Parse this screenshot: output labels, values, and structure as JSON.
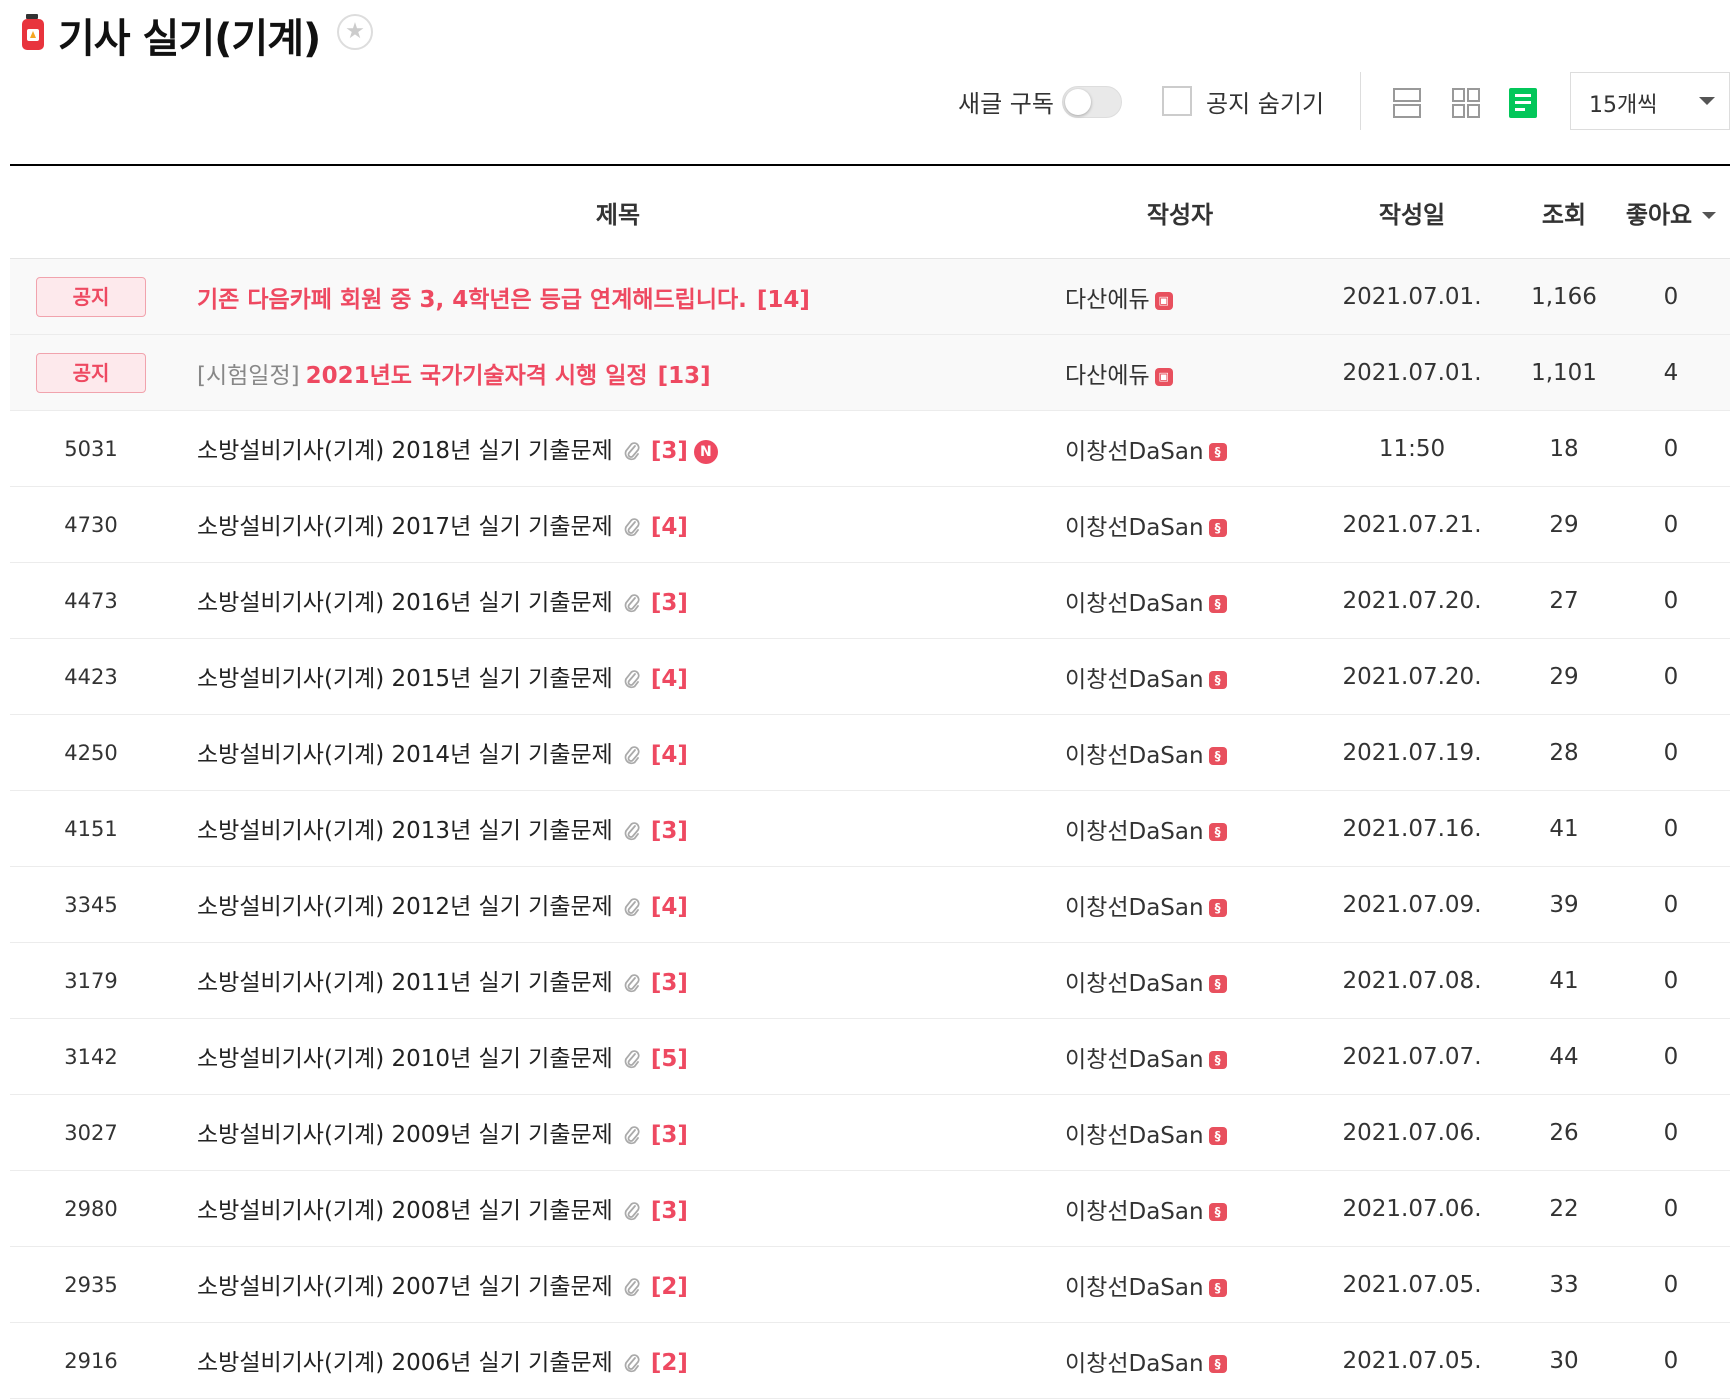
{
  "board": {
    "title": "기사 실기(기계)",
    "star_icon": "star-icon",
    "board_icon": "fire-extinguisher-icon"
  },
  "toolbar": {
    "subscribe_label": "새글 구독",
    "hide_notice_label": "공지 숨기기",
    "per_page": "15개씩",
    "view_icons": [
      "list-view-icon",
      "card-view-icon",
      "album-view-icon"
    ],
    "active_view_color": "#03c75a"
  },
  "columns": {
    "title": "제목",
    "author": "작성자",
    "date": "작성일",
    "views": "조회",
    "likes": "좋아요"
  },
  "notices": [
    {
      "badge": "공지",
      "prefix": "",
      "title": "기존 다음카페 회원 중 3, 4학년은 등급 연계해드립니다.",
      "comments": "[14]",
      "author": "다산에듀",
      "date": "2021.07.01.",
      "views": "1,166",
      "likes": "0"
    },
    {
      "badge": "공지",
      "prefix": "[시험일정]",
      "title": "2021년도 국가기술자격 시행 일정",
      "comments": "[13]",
      "author": "다산에듀",
      "date": "2021.07.01.",
      "views": "1,101",
      "likes": "4"
    }
  ],
  "posts": [
    {
      "num": "5031",
      "title": "소방설비기사(기계) 2018년 실기 기출문제",
      "comments": "[3]",
      "new": "N",
      "author": "이창선DaSan",
      "date": "11:50",
      "views": "18",
      "likes": "0"
    },
    {
      "num": "4730",
      "title": "소방설비기사(기계) 2017년 실기 기출문제",
      "comments": "[4]",
      "author": "이창선DaSan",
      "date": "2021.07.21.",
      "views": "29",
      "likes": "0"
    },
    {
      "num": "4473",
      "title": "소방설비기사(기계) 2016년 실기 기출문제",
      "comments": "[3]",
      "author": "이창선DaSan",
      "date": "2021.07.20.",
      "views": "27",
      "likes": "0"
    },
    {
      "num": "4423",
      "title": "소방설비기사(기계) 2015년 실기 기출문제",
      "comments": "[4]",
      "author": "이창선DaSan",
      "date": "2021.07.20.",
      "views": "29",
      "likes": "0"
    },
    {
      "num": "4250",
      "title": "소방설비기사(기계) 2014년 실기 기출문제",
      "comments": "[4]",
      "author": "이창선DaSan",
      "date": "2021.07.19.",
      "views": "28",
      "likes": "0"
    },
    {
      "num": "4151",
      "title": "소방설비기사(기계) 2013년 실기 기출문제",
      "comments": "[3]",
      "author": "이창선DaSan",
      "date": "2021.07.16.",
      "views": "41",
      "likes": "0"
    },
    {
      "num": "3345",
      "title": "소방설비기사(기계) 2012년 실기 기출문제",
      "comments": "[4]",
      "author": "이창선DaSan",
      "date": "2021.07.09.",
      "views": "39",
      "likes": "0"
    },
    {
      "num": "3179",
      "title": "소방설비기사(기계) 2011년 실기 기출문제",
      "comments": "[3]",
      "author": "이창선DaSan",
      "date": "2021.07.08.",
      "views": "41",
      "likes": "0"
    },
    {
      "num": "3142",
      "title": "소방설비기사(기계) 2010년 실기 기출문제",
      "comments": "[5]",
      "author": "이창선DaSan",
      "date": "2021.07.07.",
      "views": "44",
      "likes": "0"
    },
    {
      "num": "3027",
      "title": "소방설비기사(기계) 2009년 실기 기출문제",
      "comments": "[3]",
      "author": "이창선DaSan",
      "date": "2021.07.06.",
      "views": "26",
      "likes": "0"
    },
    {
      "num": "2980",
      "title": "소방설비기사(기계) 2008년 실기 기출문제",
      "comments": "[3]",
      "author": "이창선DaSan",
      "date": "2021.07.06.",
      "views": "22",
      "likes": "0"
    },
    {
      "num": "2935",
      "title": "소방설비기사(기계) 2007년 실기 기출문제",
      "comments": "[2]",
      "author": "이창선DaSan",
      "date": "2021.07.05.",
      "views": "33",
      "likes": "0"
    },
    {
      "num": "2916",
      "title": "소방설비기사(기계) 2006년 실기 기출문제",
      "comments": "[2]",
      "author": "이창선DaSan",
      "date": "2021.07.05.",
      "views": "30",
      "likes": "0"
    }
  ],
  "colors": {
    "accent_red": "#ee4961",
    "level_icon": "#e8505e"
  }
}
